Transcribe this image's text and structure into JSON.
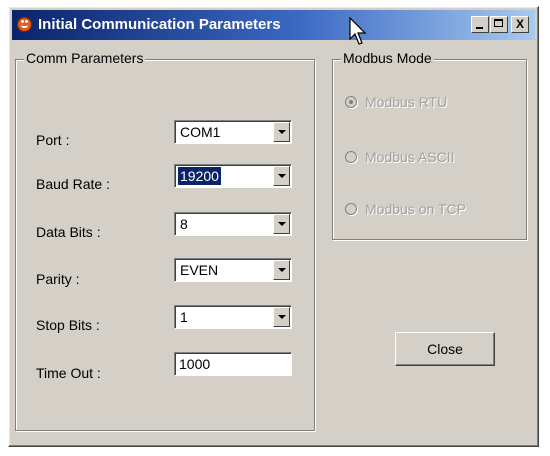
{
  "window": {
    "title": "Initial Communication Parameters",
    "buttons": {
      "minimize": "_",
      "maximize": "□",
      "close": "X"
    }
  },
  "comm_parameters": {
    "legend": "Comm Parameters",
    "fields": [
      {
        "label": "Port :",
        "value": "COM1",
        "type": "dropdown"
      },
      {
        "label": "Baud Rate :",
        "value": "19200",
        "type": "dropdown",
        "selected": true
      },
      {
        "label": "Data Bits :",
        "value": "8",
        "type": "dropdown"
      },
      {
        "label": "Parity :",
        "value": "EVEN",
        "type": "dropdown"
      },
      {
        "label": "Stop Bits :",
        "value": "1",
        "type": "dropdown"
      },
      {
        "label": "Time Out :",
        "value": "1000",
        "type": "text"
      }
    ]
  },
  "modbus_mode": {
    "legend": "Modbus Mode",
    "options": [
      {
        "label": "Modbus RTU",
        "checked": true,
        "disabled": true
      },
      {
        "label": "Modbus ASCII",
        "checked": false,
        "disabled": true
      },
      {
        "label": "Modbus on TCP",
        "checked": false,
        "disabled": true
      }
    ]
  },
  "actions": {
    "close_label": "Close"
  },
  "colors": {
    "titlebar_start": "#0a246a",
    "titlebar_end": "#a6caf0",
    "face": "#d4d0c8",
    "selection": "#0a246a",
    "disabled_text": "#a0a0a0"
  },
  "icons": [
    "app-icon",
    "minimize-icon",
    "maximize-icon",
    "close-icon",
    "chevron-down-icon",
    "mouse-pointer-icon"
  ]
}
